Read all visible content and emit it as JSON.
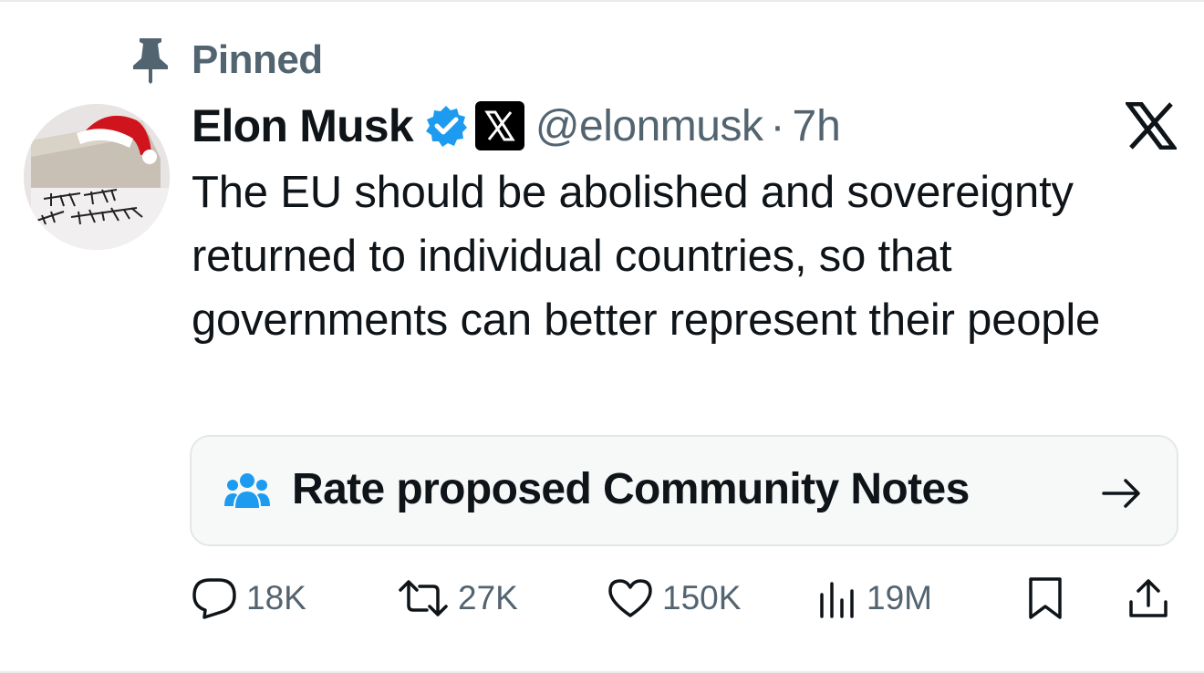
{
  "pinned": {
    "label": "Pinned"
  },
  "tweet": {
    "author_name": "Elon Musk",
    "handle": "@elonmusk",
    "separator": "·",
    "time": "7h",
    "text": "The EU should be abolished and sovereignty returned to individual countries, so that governments can better represent their people"
  },
  "community_notes": {
    "label": "Rate proposed Community Notes"
  },
  "actions": {
    "replies": "18K",
    "reposts": "27K",
    "likes": "150K",
    "views": "19M"
  },
  "icons": {
    "pin": "pin-icon",
    "verified": "verified-badge-icon",
    "affiliation": "x-affiliation-icon",
    "logo": "x-logo-icon",
    "notes": "people-icon",
    "arrow": "arrow-right-icon",
    "reply": "reply-icon",
    "repost": "repost-icon",
    "like": "heart-icon",
    "views": "views-icon",
    "bookmark": "bookmark-icon",
    "share": "share-icon"
  },
  "colors": {
    "text": "#0f1419",
    "secondary": "#536471",
    "verified": "#1d9bf0",
    "card_bg": "#f7f9f9",
    "notes_icon": "#1d9bf0"
  }
}
